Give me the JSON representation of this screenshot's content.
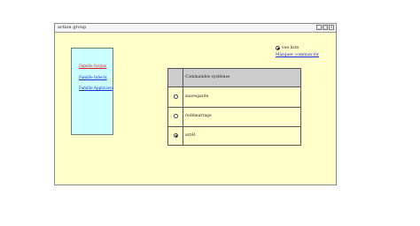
{
  "window": {
    "title": "action group",
    "buttons": [
      "_",
      "□",
      "×"
    ]
  },
  "panel": {
    "links": [
      {
        "label": "Famille Syntax",
        "color": "#d32020"
      },
      {
        "label": "Famille Infectx",
        "color": "#1a2bd0"
      },
      {
        "label": "Famille Applicacn",
        "color": "#1a2bd0"
      }
    ]
  },
  "view_option": {
    "label": "vue liste",
    "selected": true
  },
  "mode_link": "Masquer commun for",
  "table": {
    "header": "Commandes systèmes",
    "rows": [
      {
        "label": "sauvegarde",
        "selected": false
      },
      {
        "label": "redémarrage",
        "selected": false
      },
      {
        "label": "arrêt",
        "selected": true
      }
    ]
  }
}
